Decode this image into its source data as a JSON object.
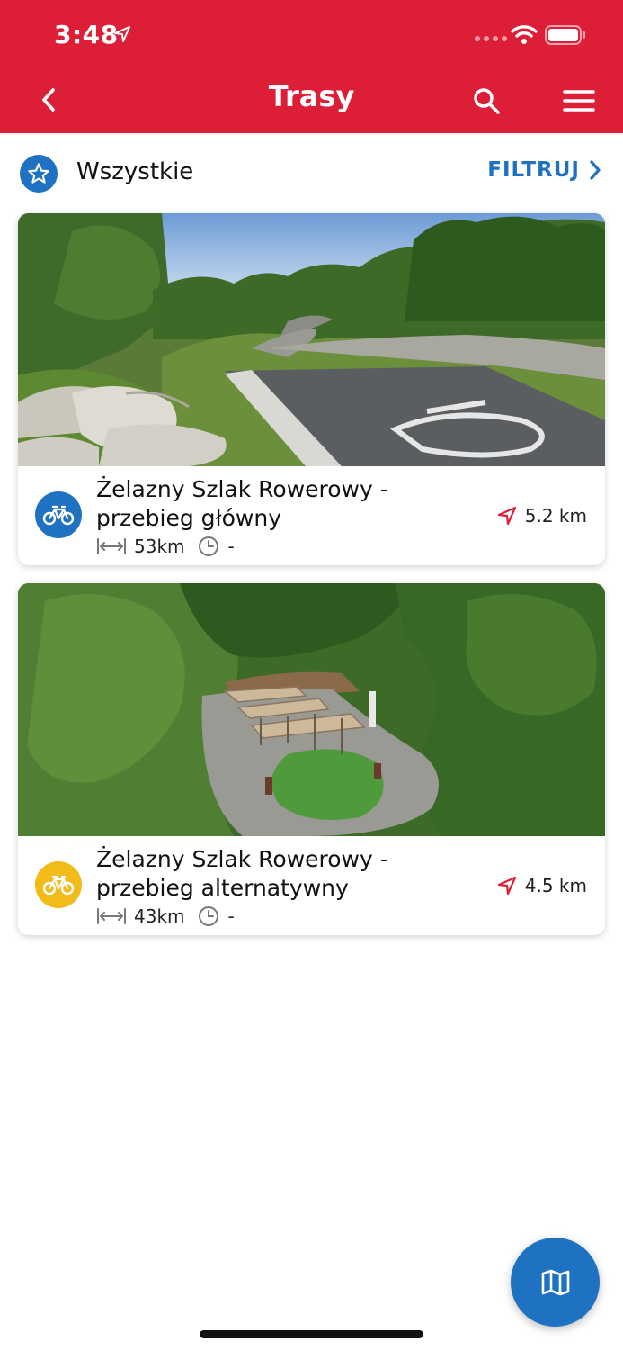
{
  "status_bar": {
    "time": "3:48"
  },
  "header": {
    "title": "Trasy"
  },
  "filter": {
    "label": "Wszystkie",
    "button_label": "FILTRUJ"
  },
  "routes": [
    {
      "title_line1": "Żelazny Szlak Rowerowy -",
      "title_line2": "przebieg główny",
      "length": "53km",
      "duration": "-",
      "distance": "5.2 km",
      "icon": "bicycle-icon",
      "icon_color": "#1f72c2"
    },
    {
      "title_line1": "Żelazny Szlak Rowerowy -",
      "title_line2": "przebieg alternatywny",
      "length": "43km",
      "duration": "-",
      "distance": "4.5 km",
      "icon": "bicycle-icon",
      "icon_color": "#f2bb1a"
    }
  ],
  "colors": {
    "brand_red": "#dc1e36",
    "accent_blue": "#1f72c2",
    "accent_yellow": "#f2bb1a"
  },
  "icons": {
    "map_button": "map-icon",
    "filter_star": "star-icon"
  }
}
